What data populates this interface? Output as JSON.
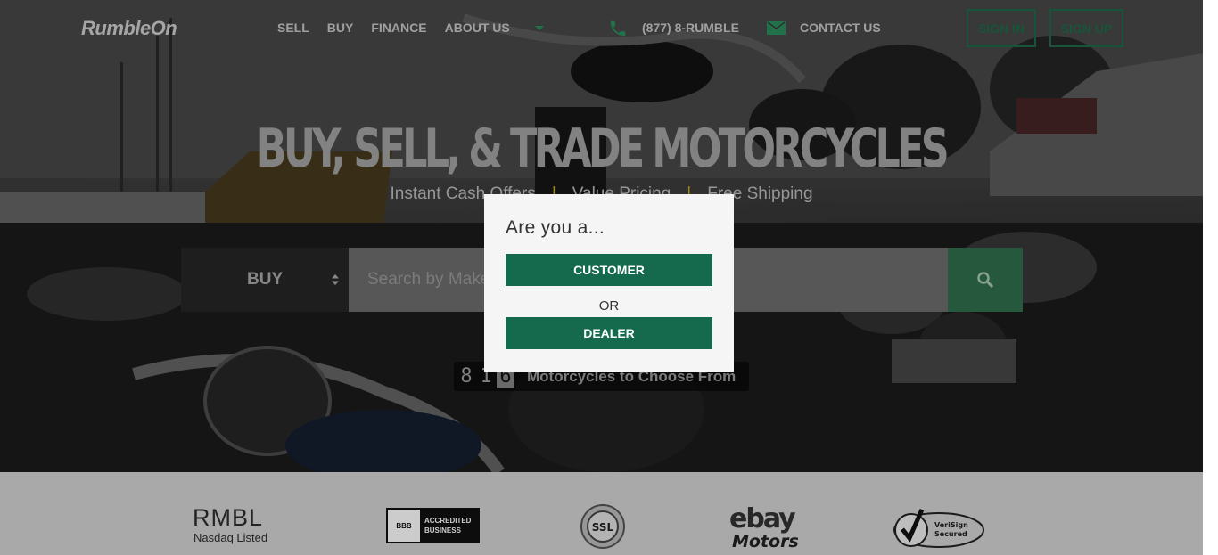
{
  "header": {
    "logo": "RumbleOn",
    "nav": [
      "SELL",
      "BUY",
      "FINANCE",
      "ABOUT US"
    ],
    "phone": "(877) 8-RUMBLE",
    "contact": "CONTACT US",
    "sign_in": "SIGN IN",
    "sign_up": "SIGN UP"
  },
  "hero": {
    "title": "BUY, SELL, & TRADE MOTORCYCLES",
    "features": [
      "Instant Cash Offers",
      "Value Pricing",
      "Free Shipping"
    ],
    "separator": "|"
  },
  "search": {
    "mode": "BUY",
    "placeholder": "Search by Make, Model"
  },
  "counter": {
    "digits": [
      "8",
      "1",
      "6"
    ],
    "label": "Motorcycles to Choose From"
  },
  "trust": {
    "rmbl": "RMBL",
    "nasdaq": "Nasdaq Listed",
    "bbb_short": "BBB",
    "bbb_line1": "ACCREDITED",
    "bbb_line2": "BUSINESS",
    "ssl": "SSL",
    "ebay": "ebay",
    "ebay_motors": "Motors",
    "verisign_line1": "VeriSign",
    "verisign_line2": "Secured"
  },
  "modal": {
    "title": "Are you a...",
    "customer": "CUSTOMER",
    "or": "OR",
    "dealer": "DEALER"
  },
  "colors": {
    "accent_green": "#156a4d",
    "outline_green": "#1e6a48",
    "separator_gold": "#c9a227"
  }
}
